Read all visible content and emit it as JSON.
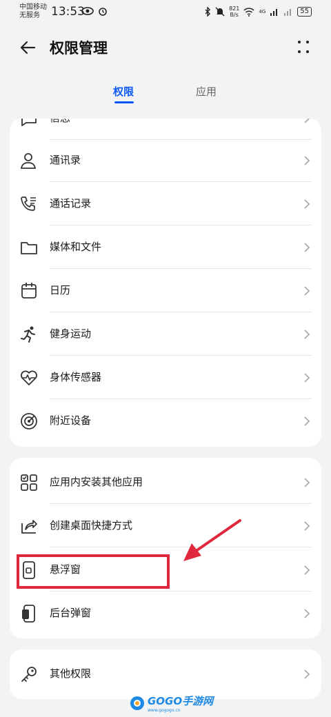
{
  "status_bar": {
    "carrier_line1": "中国移动",
    "carrier_line2": "无服务",
    "time": "13:53",
    "net_speed_value": "821",
    "net_speed_unit": "B/s",
    "network_type": "4G",
    "battery": "55",
    "icons": [
      "eye-icon",
      "alarm-icon",
      "bluetooth-icon",
      "mute-icon",
      "wifi-icon",
      "signal-icon",
      "signal-icon",
      "battery-icon"
    ]
  },
  "header": {
    "title": "权限管理",
    "back_icon": "back-arrow-icon",
    "more_icon": "more-icon"
  },
  "tabs": [
    {
      "label": "权限",
      "active": true
    },
    {
      "label": "应用",
      "active": false
    }
  ],
  "permissions_card": {
    "partial_top_label": "信息",
    "items": [
      {
        "label": "通讯录",
        "icon": "contacts-icon"
      },
      {
        "label": "通话记录",
        "icon": "call-log-icon"
      },
      {
        "label": "媒体和文件",
        "icon": "folder-icon"
      },
      {
        "label": "日历",
        "icon": "calendar-icon"
      },
      {
        "label": "健身运动",
        "icon": "running-icon"
      },
      {
        "label": "身体传感器",
        "icon": "heart-rate-icon"
      },
      {
        "label": "附近设备",
        "icon": "nearby-devices-icon"
      }
    ]
  },
  "special_card": {
    "items": [
      {
        "label": "应用内安装其他应用",
        "icon": "apps-grid-icon"
      },
      {
        "label": "创建桌面快捷方式",
        "icon": "shortcut-icon"
      },
      {
        "label": "悬浮窗",
        "icon": "floating-window-icon"
      },
      {
        "label": "后台弹窗",
        "icon": "background-popup-icon"
      }
    ]
  },
  "other_card": {
    "items": [
      {
        "label": "其他权限",
        "icon": "key-icon"
      }
    ]
  },
  "annotation": {
    "highlight_color": "#e0283c"
  },
  "colors": {
    "accent": "#0a59f7",
    "background": "#f1f3f5"
  },
  "watermark": {
    "logo": "GOGO手游网",
    "sub": "www.gogogo.cn"
  }
}
